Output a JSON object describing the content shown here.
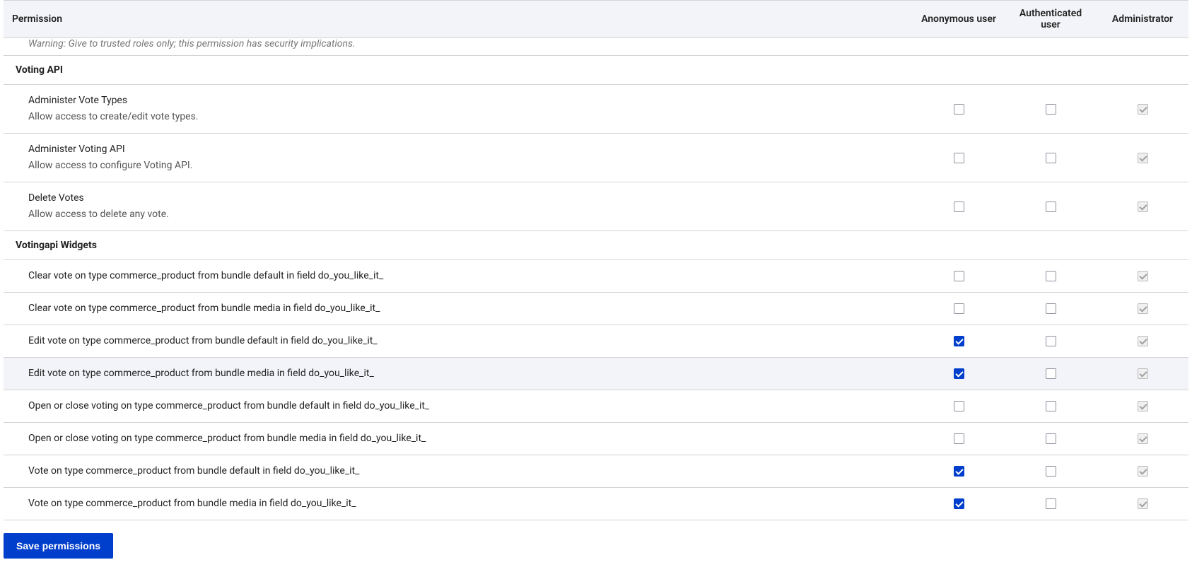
{
  "header": {
    "permission_label": "Permission",
    "roles": [
      "Anonymous user",
      "Authenticated user",
      "Administrator"
    ]
  },
  "warning": "Warning: Give to trusted roles only; this permission has security implications.",
  "modules": [
    {
      "name": "Voting API",
      "permissions": [
        {
          "title": "Administer Vote Types",
          "desc": "Allow access to create/edit vote types.",
          "anonymous": false,
          "authenticated": false,
          "admin": true,
          "admin_disabled": true
        },
        {
          "title": "Administer Voting API",
          "desc": "Allow access to configure Voting API.",
          "anonymous": false,
          "authenticated": false,
          "admin": true,
          "admin_disabled": true
        },
        {
          "title": "Delete Votes",
          "desc": "Allow access to delete any vote.",
          "anonymous": false,
          "authenticated": false,
          "admin": true,
          "admin_disabled": true
        }
      ]
    },
    {
      "name": "Votingapi Widgets",
      "permissions": [
        {
          "title": "Clear vote on type commerce_product from bundle default in field do_you_like_it_",
          "desc": "",
          "anonymous": false,
          "authenticated": false,
          "admin": true,
          "admin_disabled": true
        },
        {
          "title": "Clear vote on type commerce_product from bundle media in field do_you_like_it_",
          "desc": "",
          "anonymous": false,
          "authenticated": false,
          "admin": true,
          "admin_disabled": true
        },
        {
          "title": "Edit vote on type commerce_product from bundle default in field do_you_like_it_",
          "desc": "",
          "anonymous": true,
          "authenticated": false,
          "admin": true,
          "admin_disabled": true
        },
        {
          "title": "Edit vote on type commerce_product from bundle media in field do_you_like_it_",
          "desc": "",
          "anonymous": true,
          "authenticated": false,
          "admin": true,
          "admin_disabled": true,
          "hover": true
        },
        {
          "title": "Open or close voting on type commerce_product from bundle default in field do_you_like_it_",
          "desc": "",
          "anonymous": false,
          "authenticated": false,
          "admin": true,
          "admin_disabled": true
        },
        {
          "title": "Open or close voting on type commerce_product from bundle media in field do_you_like_it_",
          "desc": "",
          "anonymous": false,
          "authenticated": false,
          "admin": true,
          "admin_disabled": true
        },
        {
          "title": "Vote on type commerce_product from bundle default in field do_you_like_it_",
          "desc": "",
          "anonymous": true,
          "authenticated": false,
          "admin": true,
          "admin_disabled": true
        },
        {
          "title": "Vote on type commerce_product from bundle media in field do_you_like_it_",
          "desc": "",
          "anonymous": true,
          "authenticated": false,
          "admin": true,
          "admin_disabled": true
        }
      ]
    }
  ],
  "save_button_label": "Save permissions"
}
